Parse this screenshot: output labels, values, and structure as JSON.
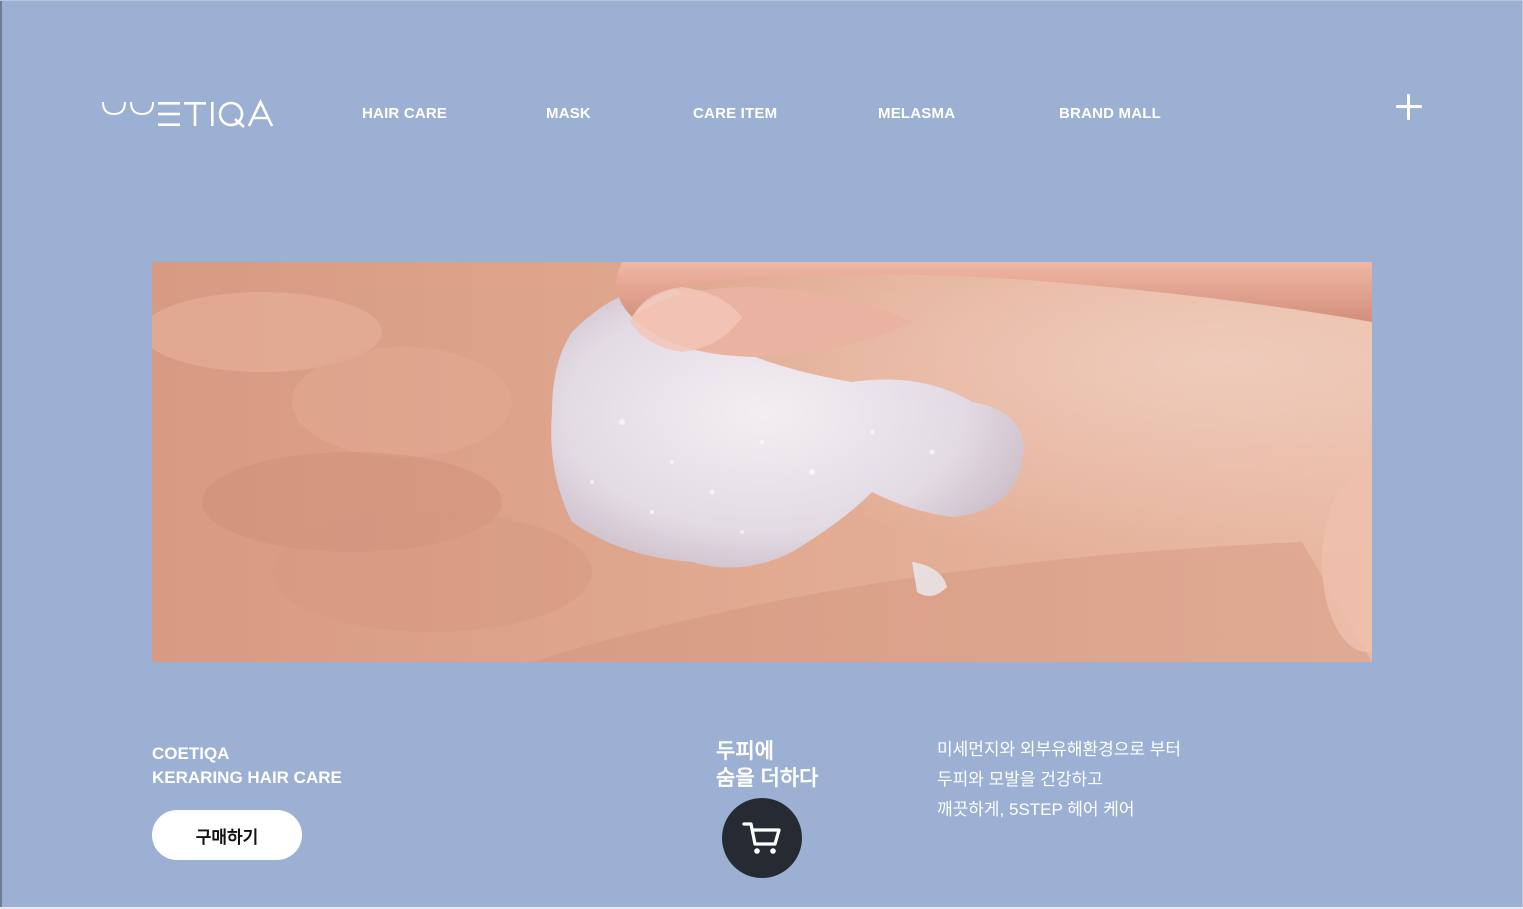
{
  "brand": {
    "logo_text": "COETIQA"
  },
  "nav": {
    "items": [
      {
        "label": "HAIR CARE"
      },
      {
        "label": "MASK"
      },
      {
        "label": "CARE ITEM"
      },
      {
        "label": "MELASMA"
      },
      {
        "label": "BRAND MALL"
      }
    ]
  },
  "hero": {
    "image": "hand applying white foam cream onto skin"
  },
  "product": {
    "brand_line1": "COETIQA",
    "brand_line2": "KERARING HAIR CARE",
    "buy_label": "구매하기"
  },
  "headline": {
    "line1": "두피에",
    "line2": "숨을 더하다"
  },
  "description": {
    "line1": "미세먼지와 외부유해환경으로 부터",
    "line2": "두피와 모발을 건강하고",
    "line3": "깨끗하게, 5STEP 헤어 케어"
  },
  "icons": {
    "menu": "plus-icon",
    "cart": "cart-icon"
  },
  "colors": {
    "background": "#9bb0d3",
    "text": "#ffffff",
    "cart_button": "#262a33",
    "buy_button": "#ffffff"
  }
}
